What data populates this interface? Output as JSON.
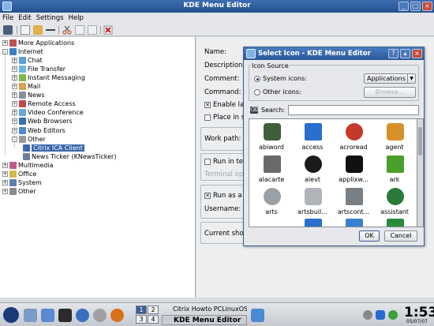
{
  "window": {
    "title": "KDE Menu Editor"
  },
  "menubar": [
    "File",
    "Edit",
    "Settings",
    "Help"
  ],
  "tree": {
    "items": [
      {
        "label": "More Applications",
        "level": 0,
        "expander": "+",
        "color": "#c05050"
      },
      {
        "label": "Internet",
        "level": 0,
        "expander": "-",
        "color": "#3c7fc7"
      },
      {
        "label": "Chat",
        "level": 1,
        "expander": "+",
        "color": "#5aa0d8"
      },
      {
        "label": "File Transfer",
        "level": 1,
        "expander": "+",
        "color": "#6fb6e0"
      },
      {
        "label": "Instant Messaging",
        "level": 1,
        "expander": "+",
        "color": "#7fb84a"
      },
      {
        "label": "Mail",
        "level": 1,
        "expander": "+",
        "color": "#d8a24a"
      },
      {
        "label": "News",
        "level": 1,
        "expander": "+",
        "color": "#8a8fa0"
      },
      {
        "label": "Remote Access",
        "level": 1,
        "expander": "+",
        "color": "#c04a4a"
      },
      {
        "label": "Video Conference",
        "level": 1,
        "expander": "+",
        "color": "#6aa6d6"
      },
      {
        "label": "Web Browsers",
        "level": 1,
        "expander": "+",
        "color": "#3a6fb0"
      },
      {
        "label": "Web Editors",
        "level": 1,
        "expander": "+",
        "color": "#4a8ad0"
      },
      {
        "label": "Other",
        "level": 1,
        "expander": "-",
        "color": "#9a9a9a"
      },
      {
        "label": "Citrix ICA Client",
        "level": 2,
        "expander": "",
        "color": "#3a66ab",
        "selected": true
      },
      {
        "label": "News Ticker (KNewsTicker)",
        "level": 2,
        "expander": "",
        "color": "#6a7f9a"
      },
      {
        "label": "Multimedia",
        "level": 0,
        "expander": "+",
        "color": "#c05a8a"
      },
      {
        "label": "Office",
        "level": 0,
        "expander": "+",
        "color": "#d8b84a"
      },
      {
        "label": "System",
        "level": 0,
        "expander": "+",
        "color": "#5a7fb0"
      },
      {
        "label": "Other",
        "level": 0,
        "expander": "+",
        "color": "#8a8a8a"
      }
    ]
  },
  "props": {
    "name_label": "Name:",
    "description_label": "Description:",
    "comment_label": "Comment:",
    "command_label": "Command:",
    "enable_label": "Enable lau",
    "place_label": "Place in sy",
    "workpath_label": "Work path:",
    "run_terminal_label": "Run in ter",
    "terminal_options_label": "Terminal opti",
    "run_as_label": "Run as a d",
    "username_label": "Username:",
    "shortcut_label": "Current shor"
  },
  "dialog": {
    "title": "Select Icon - KDE Menu Editor",
    "group_title": "Icon Source",
    "system_icons_label": "System icons:",
    "other_icons_label": "Other icons:",
    "combo_value": "Applications",
    "browse_label": "Browse...",
    "search_label": "Search:",
    "ok_label": "OK",
    "cancel_label": "Cancel",
    "icons": [
      {
        "name": "abiword",
        "color": "#3f5f3a"
      },
      {
        "name": "access",
        "color": "#2a6fd0"
      },
      {
        "name": "acroread",
        "color": "#c43a2a"
      },
      {
        "name": "agent",
        "color": "#d8902a"
      },
      {
        "name": "alacarte",
        "color": "#6a6a6a"
      },
      {
        "name": "alevt",
        "color": "#1a1a1a"
      },
      {
        "name": "applixw...",
        "color": "#111111"
      },
      {
        "name": "ark",
        "color": "#4aa02a"
      },
      {
        "name": "arts",
        "color": "#9aa0a6"
      },
      {
        "name": "artsbuil...",
        "color": "#b0b4b8"
      },
      {
        "name": "artscont...",
        "color": "#7a7f85"
      },
      {
        "name": "assistant",
        "color": "#2a7a3a"
      }
    ]
  },
  "taskbar": {
    "pager": [
      "1",
      "2",
      "3",
      "4"
    ],
    "tasks": [
      "Citrix Howto PCLinuxOS",
      "KDE Menu Editor"
    ],
    "clock": "1:53",
    "date": "05/07/07"
  }
}
